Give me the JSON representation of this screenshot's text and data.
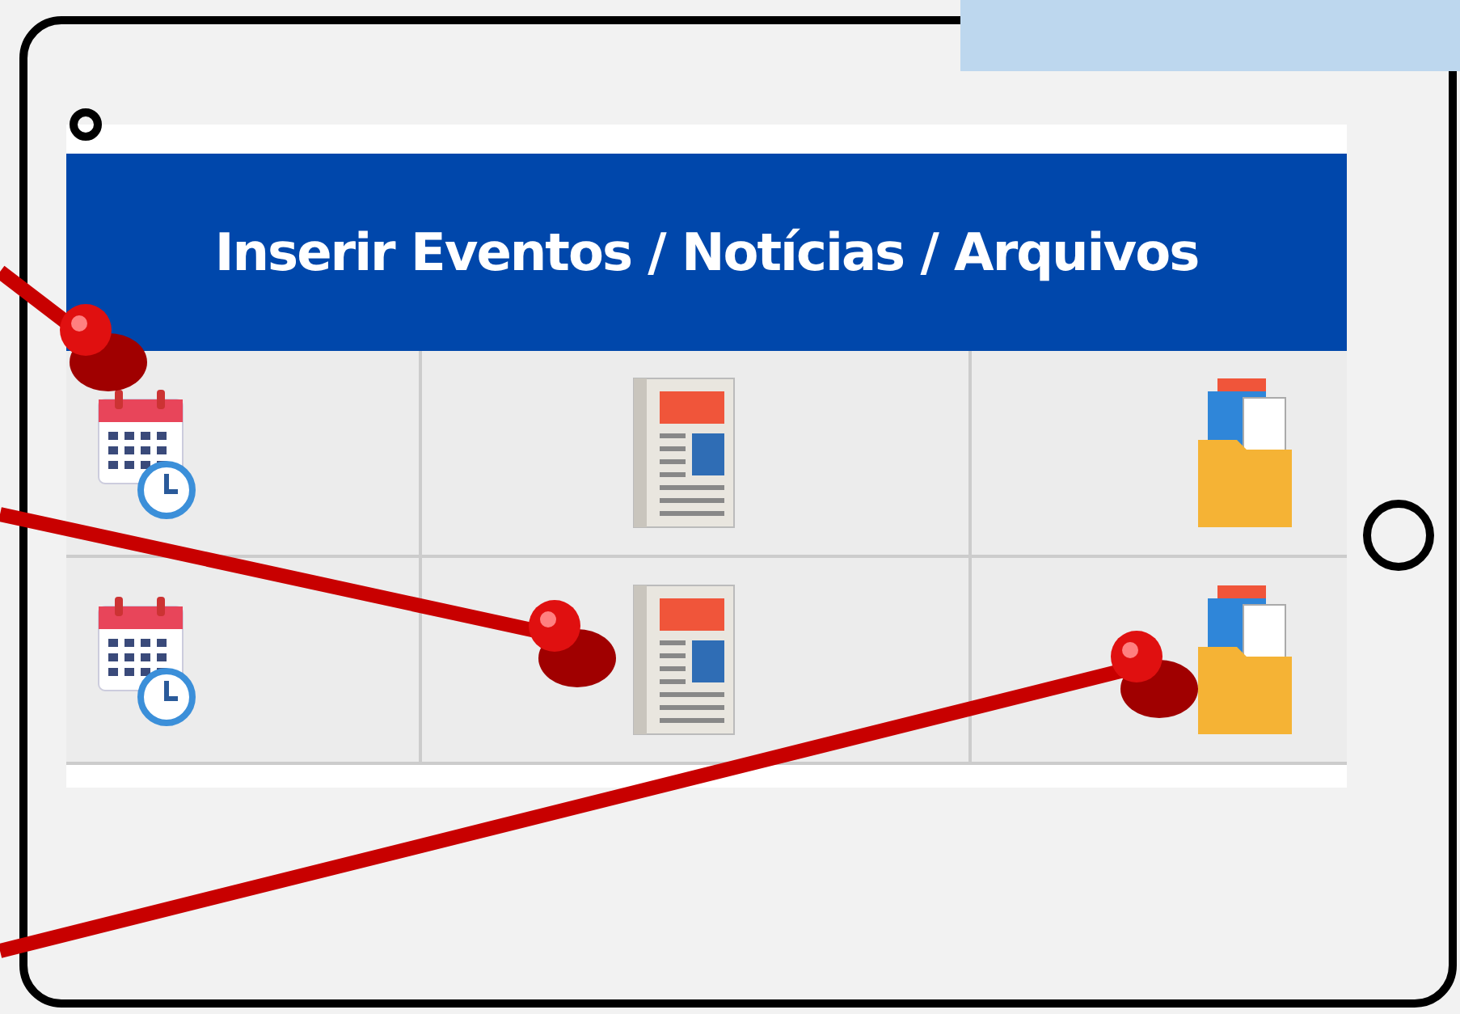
{
  "table": {
    "title": "Inserir Eventos / Notícias / Arquivos",
    "rows": [
      {
        "cells": [
          {
            "kind": "calendar"
          },
          {
            "kind": "newspaper"
          },
          {
            "kind": "folder"
          }
        ]
      },
      {
        "cells": [
          {
            "kind": "calendar"
          },
          {
            "kind": "newspaper"
          },
          {
            "kind": "folder"
          }
        ]
      }
    ]
  }
}
